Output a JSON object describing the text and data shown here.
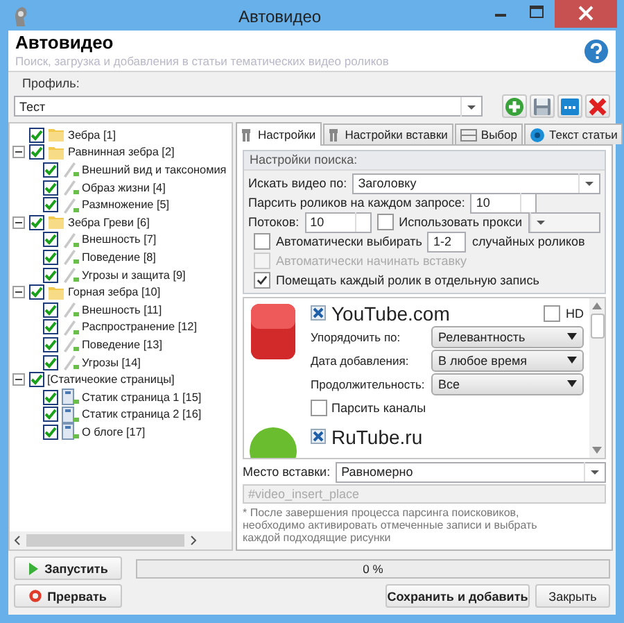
{
  "window": {
    "title": "Автовидео"
  },
  "header": {
    "title": "Автовидео",
    "subtitle": "Поиск, загрузка и добавления в статьи тематических видео роликов"
  },
  "profile": {
    "label": "Профиль:",
    "value": "Тест"
  },
  "tree": [
    {
      "label": "Зебра  [1]",
      "kind": "folder",
      "checked": true
    },
    {
      "label": "Равнинная зебра [2]",
      "kind": "folder",
      "checked": true,
      "expanded": true,
      "children": [
        {
          "label": "Внешний вид и таксономия",
          "kind": "article",
          "checked": true
        },
        {
          "label": "Образ жизни [4]",
          "kind": "article",
          "checked": true
        },
        {
          "label": "Размножение [5]",
          "kind": "article",
          "checked": true
        }
      ]
    },
    {
      "label": "Зебра Греви [6]",
      "kind": "folder",
      "checked": true,
      "expanded": true,
      "children": [
        {
          "label": "Внешность [7]",
          "kind": "article",
          "checked": true
        },
        {
          "label": "Поведение [8]",
          "kind": "article",
          "checked": true
        },
        {
          "label": "Угрозы и защита [9]",
          "kind": "article",
          "checked": true
        }
      ]
    },
    {
      "label": "Горная зебра [10]",
      "kind": "folder",
      "checked": true,
      "expanded": true,
      "children": [
        {
          "label": "Внешность [11]",
          "kind": "article",
          "checked": true
        },
        {
          "label": "Распространение [12]",
          "kind": "article",
          "checked": true
        },
        {
          "label": "Поведение [13]",
          "kind": "article",
          "checked": true
        },
        {
          "label": "Угрозы [14]",
          "kind": "article",
          "checked": true
        }
      ]
    },
    {
      "label": "[Статичеокие страницы]",
      "kind": "none",
      "checked": true,
      "expanded": true,
      "children": [
        {
          "label": "Статик страница 1 [15]",
          "kind": "page",
          "checked": true
        },
        {
          "label": "Статик страница 2 [16]",
          "kind": "page",
          "checked": true
        },
        {
          "label": "О блоге [17]",
          "kind": "page",
          "checked": true
        }
      ]
    }
  ],
  "tabs": [
    {
      "label": "Настройки",
      "selected": true
    },
    {
      "label": "Настройки вставки",
      "selected": false
    },
    {
      "label": "Выбор",
      "selected": false
    },
    {
      "label": "Текст статьи",
      "selected": false
    }
  ],
  "search_settings": {
    "title": "Настройки поиска:",
    "search_by": {
      "label": "Искать видео по:",
      "value": "Заголовку"
    },
    "per_query": {
      "label": "Парсить роликов на каждом запросе:",
      "value": "10"
    },
    "threads": {
      "label": "Потоков:",
      "value": "10"
    },
    "use_proxy": {
      "label": "Использовать прокси",
      "checked": false
    },
    "auto_pick": {
      "label": "Автоматически выбирать",
      "checked": false,
      "value": "1-2",
      "suffix": "случайных роликов"
    },
    "auto_insert": {
      "label": "Автоматически начинать вставку",
      "checked": false,
      "disabled": true
    },
    "separate_post": {
      "label": "Помещать каждый ролик в отдельную запись",
      "checked": true
    }
  },
  "sources": [
    {
      "name": "YouTube.com",
      "checked": true,
      "hd": {
        "label": "HD",
        "checked": false
      },
      "fields": [
        {
          "label": "Упорядочить по:",
          "value": "Релевантность"
        },
        {
          "label": "Дата добавления:",
          "value": "В любое время"
        },
        {
          "label": "Продолжительность:",
          "value": "Все"
        }
      ],
      "channels": {
        "label": "Парсить каналы",
        "checked": false
      }
    },
    {
      "name": "RuTube.ru",
      "checked": true
    }
  ],
  "insert_place": {
    "label": "Место вставки:",
    "value": "Равномерно"
  },
  "insert_tag": {
    "value": "#video_insert_place",
    "disabled": true
  },
  "note": "* После завершения процесса парсинга поисковиков, необходимо активировать отмеченные записи и выбрать каждой подходящие рисунки",
  "progress": {
    "level": 0,
    "text": "0 %"
  },
  "buttons": {
    "start": "Запустить",
    "stop": "Прервать",
    "save": "Сохранить и добавить",
    "close": "Закрыть"
  }
}
